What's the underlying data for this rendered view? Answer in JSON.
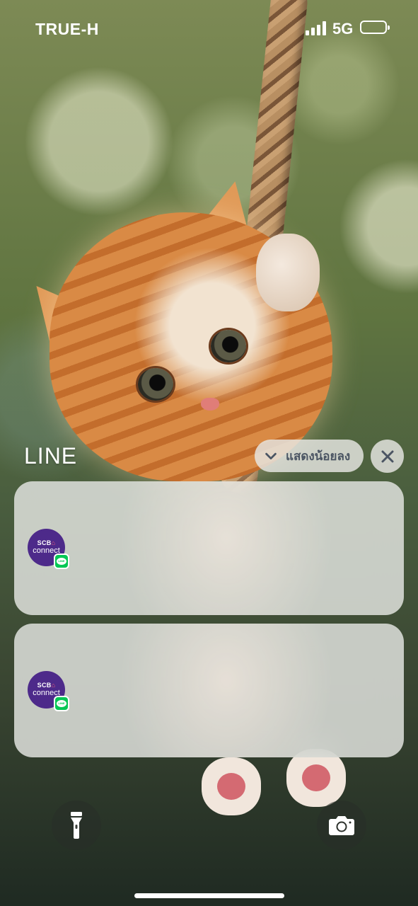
{
  "status_bar": {
    "carrier": "TRUE-H",
    "network": "5G",
    "signal_bars": 4,
    "battery_icon": "battery-icon"
  },
  "notification_group": {
    "app_name": "LINE",
    "show_less_label": "แสดงน้อยลง",
    "show_less_icon": "chevron-down-icon",
    "close_icon": "close-icon"
  },
  "notifications": [
    {
      "app_icon": {
        "line1": "SCB",
        "line1_symbol": "⌂",
        "line2": "connect",
        "color": "#4d2a8a"
      },
      "badge": {
        "text": "LINE",
        "color": "#06c755"
      }
    },
    {
      "app_icon": {
        "line1": "SCB",
        "line1_symbol": "⌂",
        "line2": "connect",
        "color": "#4d2a8a"
      },
      "badge": {
        "text": "LINE",
        "color": "#06c755"
      }
    }
  ],
  "lock_screen": {
    "left_button_icon": "flashlight-icon",
    "right_button_icon": "camera-icon"
  }
}
